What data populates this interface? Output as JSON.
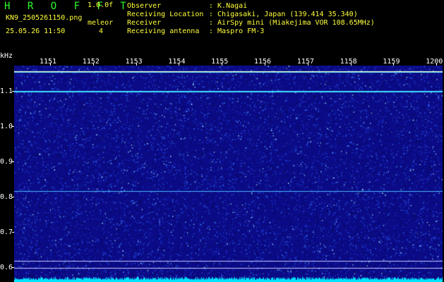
{
  "header": {
    "title": "H R O F F T",
    "version": "1.0.0f",
    "filename": "KN9_2505261150.png",
    "mode": "meleor",
    "timestamp": "25.05.26 11:50",
    "count": "4"
  },
  "info": {
    "observer_label": "Observer",
    "observer_value": ": K.Nagai",
    "location_label": "Receiving Location",
    "location_value": ": Chigasaki, Japan (139.414 35.340)",
    "receiver_label": "Receiver",
    "receiver_value": ": AirSpy mini (Miakejima VOR 108.65MHz)",
    "antenna_label": "Receiving antenna",
    "antenna_value": ": Maspro FM-3"
  },
  "axis": {
    "y_unit": "kHz",
    "y_labels": [
      "1.1",
      "1.0",
      "0.9",
      "0.8",
      "0.7",
      "0.6"
    ],
    "x_labels": [
      "1151",
      "1152",
      "1153",
      "1154",
      "1155",
      "1156",
      "1157",
      "1158",
      "1159",
      "1200"
    ]
  },
  "colors": {
    "background": "#000000",
    "spectrum": "#0b0b88",
    "header_text": "#ffff3a",
    "title_text": "#2cff2c",
    "trace": "#00e5ff"
  }
}
